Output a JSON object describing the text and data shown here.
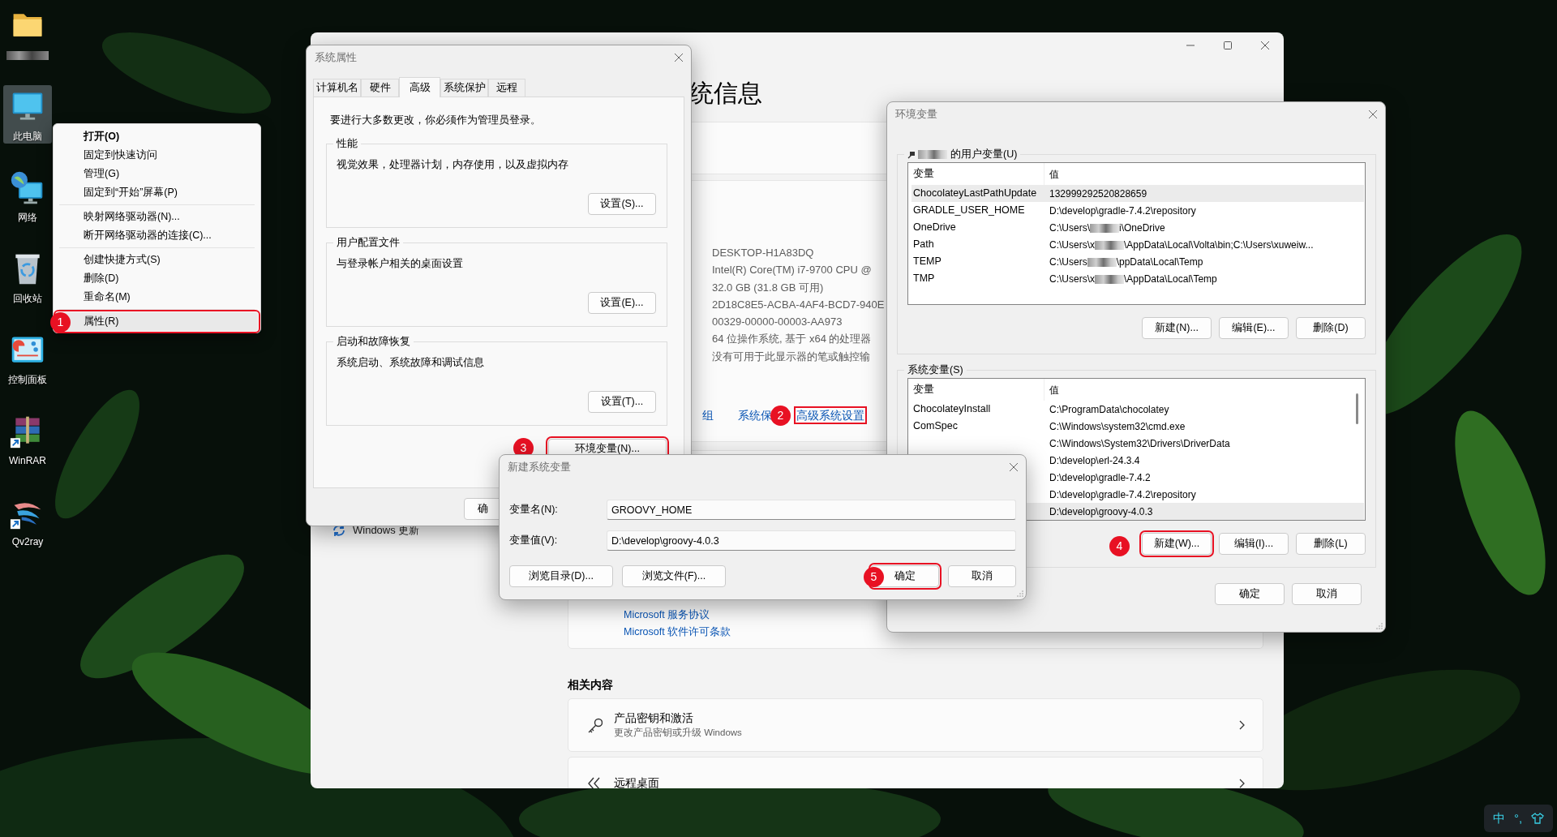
{
  "desktop": {
    "icons": [
      {
        "kind": "folder",
        "label_redacted": true,
        "selected": false
      },
      {
        "kind": "computer",
        "label": "此电脑",
        "selected": true
      },
      {
        "kind": "network",
        "label": "网络",
        "selected": false
      },
      {
        "kind": "recycle-bin",
        "label": "回收站",
        "selected": false
      },
      {
        "kind": "control-panel",
        "label": "控制面板",
        "selected": false
      },
      {
        "kind": "archive",
        "label": "WinRAR",
        "selected": false,
        "shortcut": true
      },
      {
        "kind": "bird",
        "label": "Qv2ray",
        "selected": false,
        "shortcut": true
      }
    ]
  },
  "context_menu": {
    "groups": [
      [
        {
          "label": "打开(O)",
          "bold": true,
          "selected": false
        },
        {
          "label": "固定到快速访问",
          "bold": false,
          "selected": false
        },
        {
          "label": "管理(G)",
          "bold": false,
          "selected": false
        },
        {
          "label": "固定到“开始”屏幕(P)",
          "bold": false,
          "selected": false
        }
      ],
      [
        {
          "label": "映射网络驱动器(N)...",
          "bold": false,
          "selected": false
        },
        {
          "label": "断开网络驱动器的连接(C)...",
          "bold": false,
          "selected": false
        }
      ],
      [
        {
          "label": "创建快捷方式(S)",
          "bold": false,
          "selected": false
        },
        {
          "label": "删除(D)",
          "bold": false,
          "selected": false
        },
        {
          "label": "重命名(M)",
          "bold": false,
          "selected": false
        }
      ],
      [
        {
          "label": "属性(R)",
          "bold": false,
          "selected": true,
          "step": "1"
        }
      ]
    ]
  },
  "settings_window": {
    "title": "统信息",
    "sidebar": [
      {
        "kind": "update",
        "label": "Windows 更新"
      }
    ],
    "specs": [
      "DESKTOP-H1A83DQ",
      "Intel(R) Core(TM) i7-9700 CPU @",
      "32.0 GB (31.8 GB 可用)",
      "2D18C8E5-ACBA-4AF4-BCD7-940E",
      "00329-00000-00003-AA973",
      "64 位操作系统, 基于 x64 的处理器",
      "没有可用于此显示器的笔或触控输"
    ],
    "links": [
      {
        "label": "组"
      },
      {
        "label": "系统保"
      },
      {
        "label": "高级系统设置",
        "step": "2"
      }
    ],
    "legal_links": [
      "Microsoft 服务协议",
      "Microsoft 软件许可条款"
    ],
    "related": {
      "heading": "相关内容",
      "items": [
        {
          "kind": "key",
          "title": "产品密钥和激活",
          "subtitle": "更改产品密钥或升级 Windows"
        },
        {
          "kind": "remote-desktop",
          "title": "远程桌面"
        }
      ]
    }
  },
  "system_properties": {
    "title": "系统属性",
    "tabs": [
      {
        "label": "计算机名",
        "selected": false
      },
      {
        "label": "硬件",
        "selected": false
      },
      {
        "label": "高级",
        "selected": true
      },
      {
        "label": "系统保护",
        "selected": false
      },
      {
        "label": "远程",
        "selected": false
      }
    ],
    "note": "要进行大多数更改，你必须作为管理员登录。",
    "groups": [
      {
        "title": "性能",
        "description": "视觉效果，处理器计划，内存使用，以及虚拟内存",
        "button": "设置(S)..."
      },
      {
        "title": "用户配置文件",
        "description": "与登录帐户相关的桌面设置",
        "button": "设置(E)..."
      },
      {
        "title": "启动和故障恢复",
        "description": "系统启动、系统故障和调试信息",
        "button": "设置(T)..."
      }
    ],
    "env_button": {
      "label": "环境变量(N)...",
      "step": "3"
    },
    "footer_buttons": [
      "确"
    ]
  },
  "environment_variables": {
    "title": "环境变量",
    "user_vars": {
      "owner_redacted": true,
      "title": "的用户变量(U)",
      "columns": [
        "变量",
        "值"
      ],
      "rows": [
        {
          "name": "ChocolateyLastPathUpdate",
          "value": [
            "132999292520828659"
          ],
          "selected": true
        },
        {
          "name": "GRADLE_USER_HOME",
          "value": [
            "D:\\develop\\gradle-7.4.2\\repository"
          ],
          "selected": false
        },
        {
          "name": "OneDrive",
          "value": [
            "C:\\Users\\",
            "i\\OneDrive"
          ],
          "selected": false
        },
        {
          "name": "Path",
          "value": [
            "C:\\Users\\x",
            "\\AppData\\Local\\Volta\\bin;C:\\Users\\xuweiw..."
          ],
          "selected": false
        },
        {
          "name": "TEMP",
          "value": [
            "C:\\Users",
            "\\ppData\\Local\\Temp"
          ],
          "selected": false
        },
        {
          "name": "TMP",
          "value": [
            "C:\\Users\\x",
            "\\AppData\\Local\\Temp"
          ],
          "selected": false
        }
      ],
      "buttons": [
        {
          "label": "新建(N)..."
        },
        {
          "label": "编辑(E)..."
        },
        {
          "label": "删除(D)"
        }
      ]
    },
    "system_vars": {
      "title": "系统变量(S)",
      "columns": [
        "变量",
        "值"
      ],
      "rows": [
        {
          "name": "ChocolateyInstall",
          "value": [
            "C:\\ProgramData\\chocolatey"
          ],
          "selected": false
        },
        {
          "name": "ComSpec",
          "value": [
            "C:\\Windows\\system32\\cmd.exe"
          ],
          "selected": false
        },
        {
          "value": [
            "C:\\Windows\\System32\\Drivers\\DriverData"
          ],
          "selected": false
        },
        {
          "value": [
            "D:\\develop\\erl-24.3.4"
          ],
          "selected": false
        },
        {
          "value": [
            "D:\\develop\\gradle-7.4.2"
          ],
          "selected": false
        },
        {
          "value": [
            "D:\\develop\\gradle-7.4.2\\repository"
          ],
          "selected": false
        },
        {
          "value": [
            "D:\\develop\\groovy-4.0.3"
          ],
          "selected": true
        }
      ],
      "buttons": [
        {
          "label": "新建(W)...",
          "step": "4"
        },
        {
          "label": "编辑(I)..."
        },
        {
          "label": "删除(L)"
        }
      ]
    },
    "buttons": [
      "确定",
      "取消"
    ]
  },
  "new_variable_dialog": {
    "title": "新建系统变量",
    "fields": [
      {
        "label": "变量名(N):",
        "value": "GROOVY_HOME"
      },
      {
        "label": "变量值(V):",
        "value": "D:\\develop\\groovy-4.0.3"
      }
    ],
    "browse_buttons": [
      {
        "label": "浏览目录(D)..."
      },
      {
        "label": "浏览文件(F)..."
      }
    ],
    "dialog_buttons": [
      {
        "label": "确定",
        "step": "5"
      },
      {
        "label": "取消"
      }
    ]
  },
  "ime_indicator": {
    "items": [
      "中",
      "°,"
    ]
  }
}
